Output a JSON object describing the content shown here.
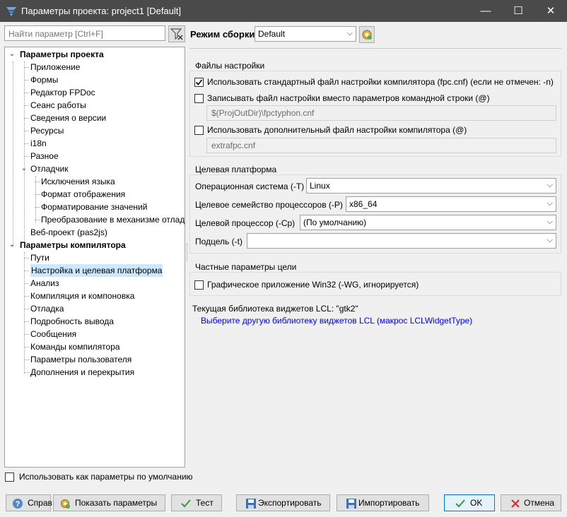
{
  "window": {
    "title": "Параметры проекта: project1 [Default]"
  },
  "search": {
    "placeholder": "Найти параметр [Ctrl+F]"
  },
  "tree": {
    "project_options": "Параметры проекта",
    "items_project": [
      "Приложение",
      "Формы",
      "Редактор FPDoc",
      "Сеанс работы",
      "Сведения о версии",
      "Ресурсы",
      "i18n",
      "Разное"
    ],
    "debugger": "Отладчик",
    "items_debugger": [
      "Исключения языка",
      "Формат отображения",
      "Форматирование значений",
      "Преобразование в механизме отладч"
    ],
    "web_project": "Веб-проект (pas2js)",
    "compiler_options": "Параметры компилятора",
    "items_compiler": [
      "Пути",
      "Настройка и целевая платформа",
      "Анализ",
      "Компиляция и компоновка",
      "Отладка",
      "Подробность вывода",
      "Сообщения",
      "Команды компилятора",
      "Параметры пользователя",
      "Дополнения и перекрытия"
    ],
    "selected": "Настройка и целевая платформа"
  },
  "use_as_default": {
    "label": "Использовать как параметры по умолчанию",
    "checked": false
  },
  "build_mode": {
    "label": "Режим сборки",
    "value": "Default"
  },
  "config_files": {
    "title": "Файлы настройки",
    "use_std": {
      "label": "Использовать стандартный файл настройки компилятора (fpc.cnf) (если не отмечен: -n)",
      "checked": true
    },
    "write_cfg": {
      "label": "Записывать файл настройки вместо параметров командной строки (@)",
      "checked": false
    },
    "write_cfg_path": "$(ProjOutDir)\\fpctyphon.cnf",
    "use_extra": {
      "label": "Использовать дополнительный файл настройки компилятора (@)",
      "checked": false
    },
    "extra_path": "extrafpc.cnf"
  },
  "target": {
    "title": "Целевая платформа",
    "os_label": "Операционная система (-T)",
    "os_value": "Linux",
    "cpu_family_label": "Целевое семейство процессоров (-P)",
    "cpu_family_value": "x86_64",
    "cpu_label": "Целевой процессор (-Cp)",
    "cpu_value": "(По умолчанию)",
    "subarch_label": "Подцель (-t)",
    "subarch_value": ""
  },
  "target_specific": {
    "title": "Частные параметры цели",
    "win32_gui": {
      "label": "Графическое приложение Win32 (-WG, игнорируется)",
      "checked": false
    }
  },
  "lcl": {
    "current": "Текущая библиотека виджетов LCL: \"gtk2\"",
    "link": "Выберите другую библиотеку виджетов LCL (макрос LCLWidgetType)"
  },
  "buttons": {
    "help": "Справ",
    "show_options": "Показать параметры",
    "test": "Тест",
    "export": "Экспортировать",
    "import": "Импортировать",
    "ok": "OK",
    "cancel": "Отмена"
  },
  "colors": {
    "titlebar": "#4a4a4a",
    "selection": "#cce8ff",
    "link": "#0000ff"
  }
}
